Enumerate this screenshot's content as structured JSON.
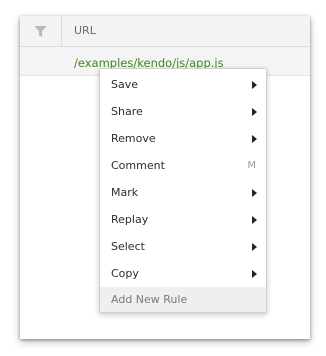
{
  "grid": {
    "header": {
      "url_column": "URL",
      "filter_icon": "filter-icon"
    },
    "rows": [
      {
        "url": "/examples/kendo/js/app.js"
      }
    ]
  },
  "context_menu": {
    "items": [
      {
        "label": "Save",
        "submenu": true,
        "shortcut": ""
      },
      {
        "label": "Share",
        "submenu": true,
        "shortcut": ""
      },
      {
        "label": "Remove",
        "submenu": true,
        "shortcut": ""
      },
      {
        "label": "Comment",
        "submenu": false,
        "shortcut": "M"
      },
      {
        "label": "Mark",
        "submenu": true,
        "shortcut": ""
      },
      {
        "label": "Replay",
        "submenu": true,
        "shortcut": ""
      },
      {
        "label": "Select",
        "submenu": true,
        "shortcut": ""
      },
      {
        "label": "Copy",
        "submenu": true,
        "shortcut": ""
      }
    ],
    "footer_label": "Add New Rule"
  },
  "colors": {
    "url_link": "#3b8a1f",
    "header_bg": "#f3f3f4",
    "footer_bg": "#efeff1"
  }
}
